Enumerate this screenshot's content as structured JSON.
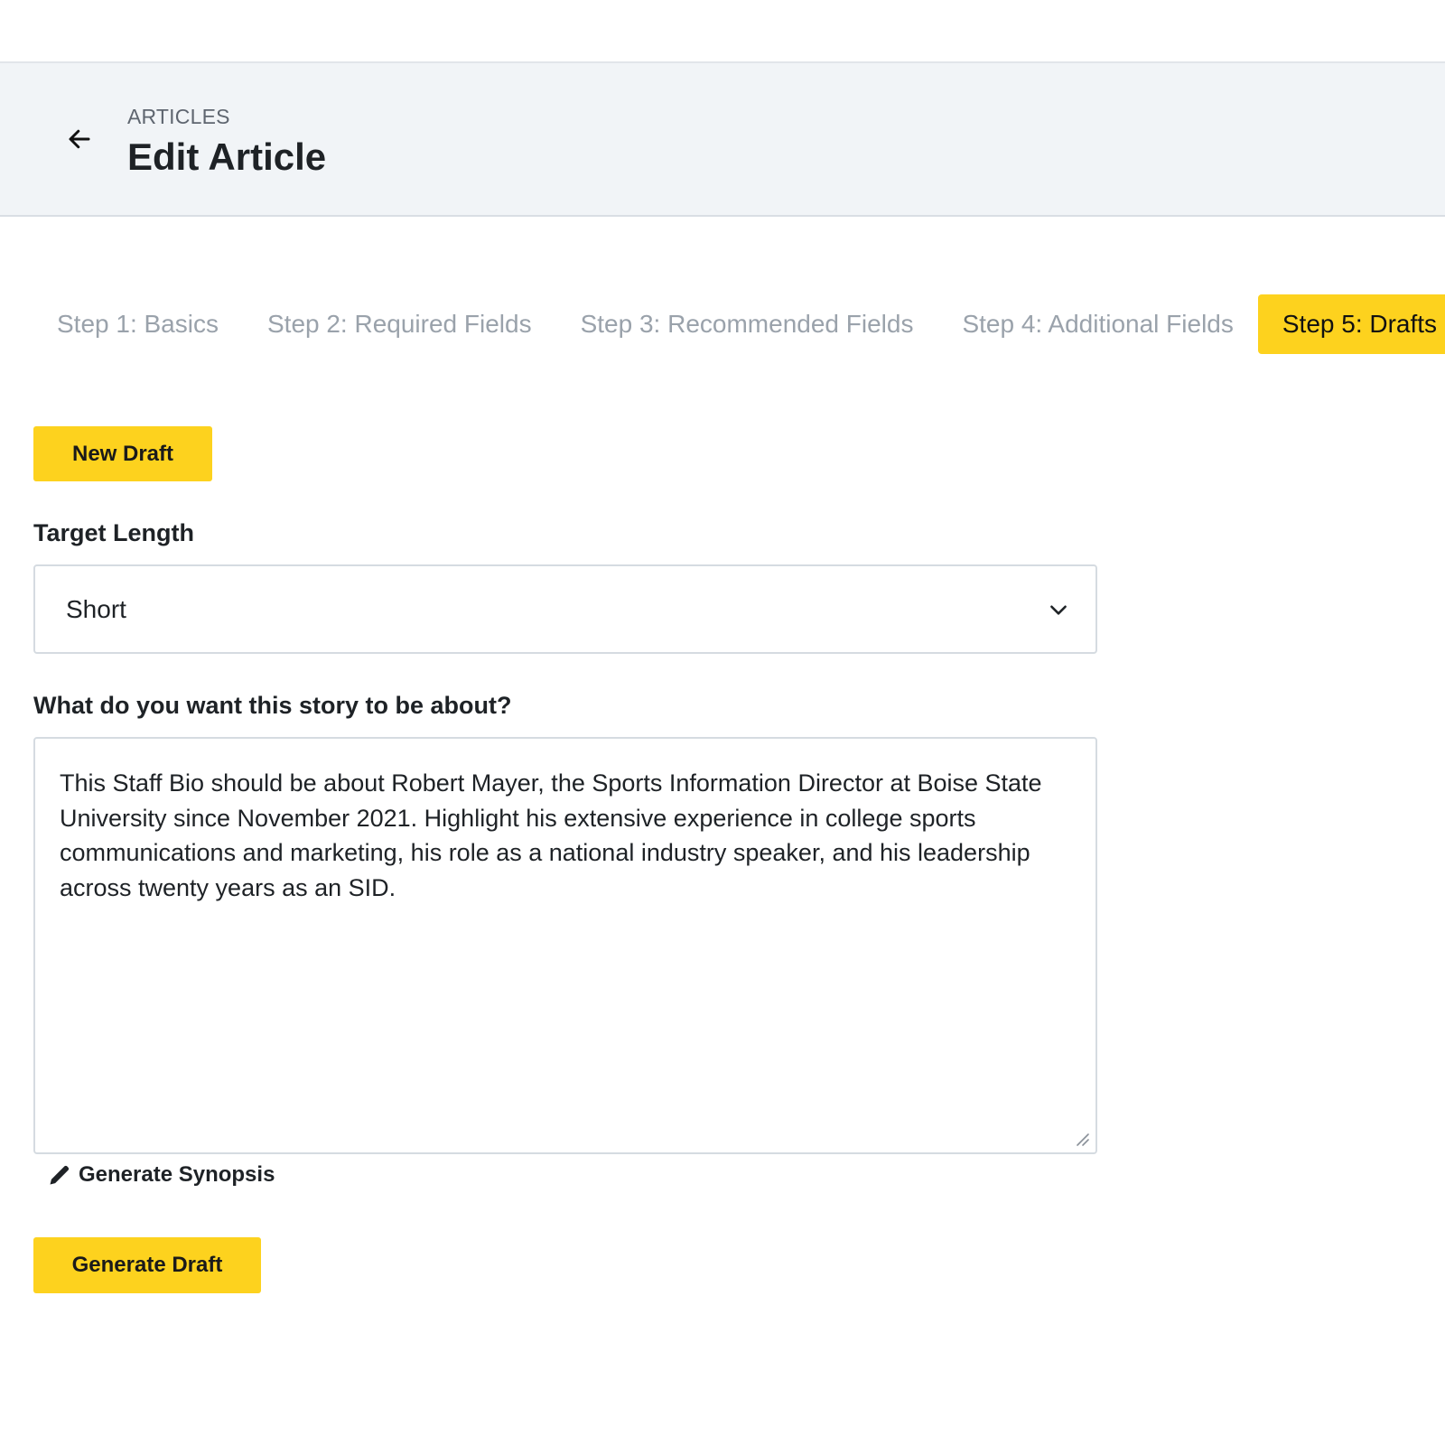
{
  "header": {
    "breadcrumb": "ARTICLES",
    "title": "Edit Article",
    "back_icon": "arrow-left-icon"
  },
  "steps": [
    {
      "label": "Step 1: Basics",
      "active": false
    },
    {
      "label": "Step 2: Required Fields",
      "active": false
    },
    {
      "label": "Step 3: Recommended Fields",
      "active": false
    },
    {
      "label": "Step 4: Additional Fields",
      "active": false
    },
    {
      "label": "Step 5: Drafts",
      "active": true
    }
  ],
  "drafts": {
    "new_draft_label": "New Draft",
    "target_length_label": "Target Length",
    "target_length_value": "Short",
    "about_label": "What do you want this story to be about?",
    "about_value": "This Staff Bio should be about Robert Mayer, the Sports Information Director at Boise State University since November 2021. Highlight his extensive experience in college sports communications and marketing, his role as a national industry speaker, and his leadership across twenty years as an SID.",
    "generate_synopsis_label": "Generate Synopsis",
    "generate_draft_label": "Generate Draft"
  },
  "colors": {
    "accent": "#fdd21e",
    "header_bg": "#f1f4f7",
    "inactive_step": "#9aa2ab"
  }
}
